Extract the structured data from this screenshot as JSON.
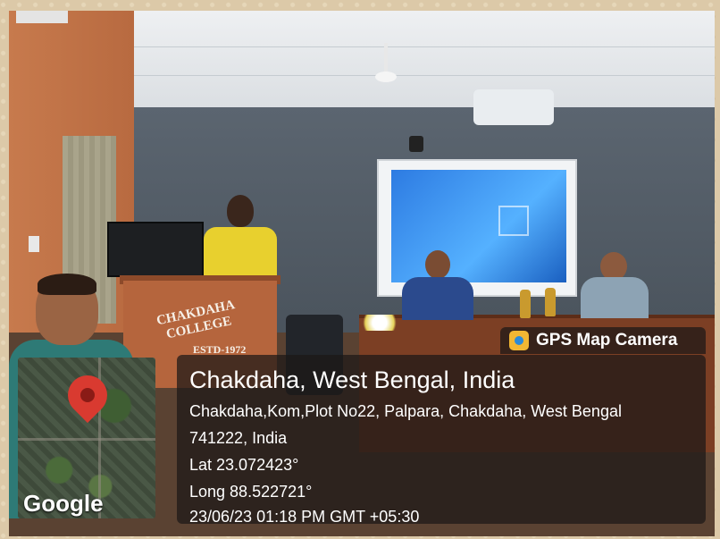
{
  "photo": {
    "podium_text": "CHAKDAHA COLLEGE",
    "podium_estd": "ESTD-1972"
  },
  "overlay": {
    "badge_label": "GPS Map Camera",
    "location_title": "Chakdaha, West Bengal, India",
    "address_line1": "Chakdaha,Kom,Plot No22, Palpara, Chakdaha, West Bengal",
    "address_line2": "741222, India",
    "lat": "Lat 23.072423°",
    "long": "Long 88.522721°",
    "timestamp": "23/06/23 01:18 PM GMT +05:30",
    "map_brand": "Google",
    "icons": [
      "map-pin-icon",
      "gps-map-camera-icon"
    ],
    "colors": {
      "pin": "#d93a30",
      "overlay_bg": "rgba(28,24,22,0.72)",
      "badge_icon": "#f2b733"
    }
  }
}
